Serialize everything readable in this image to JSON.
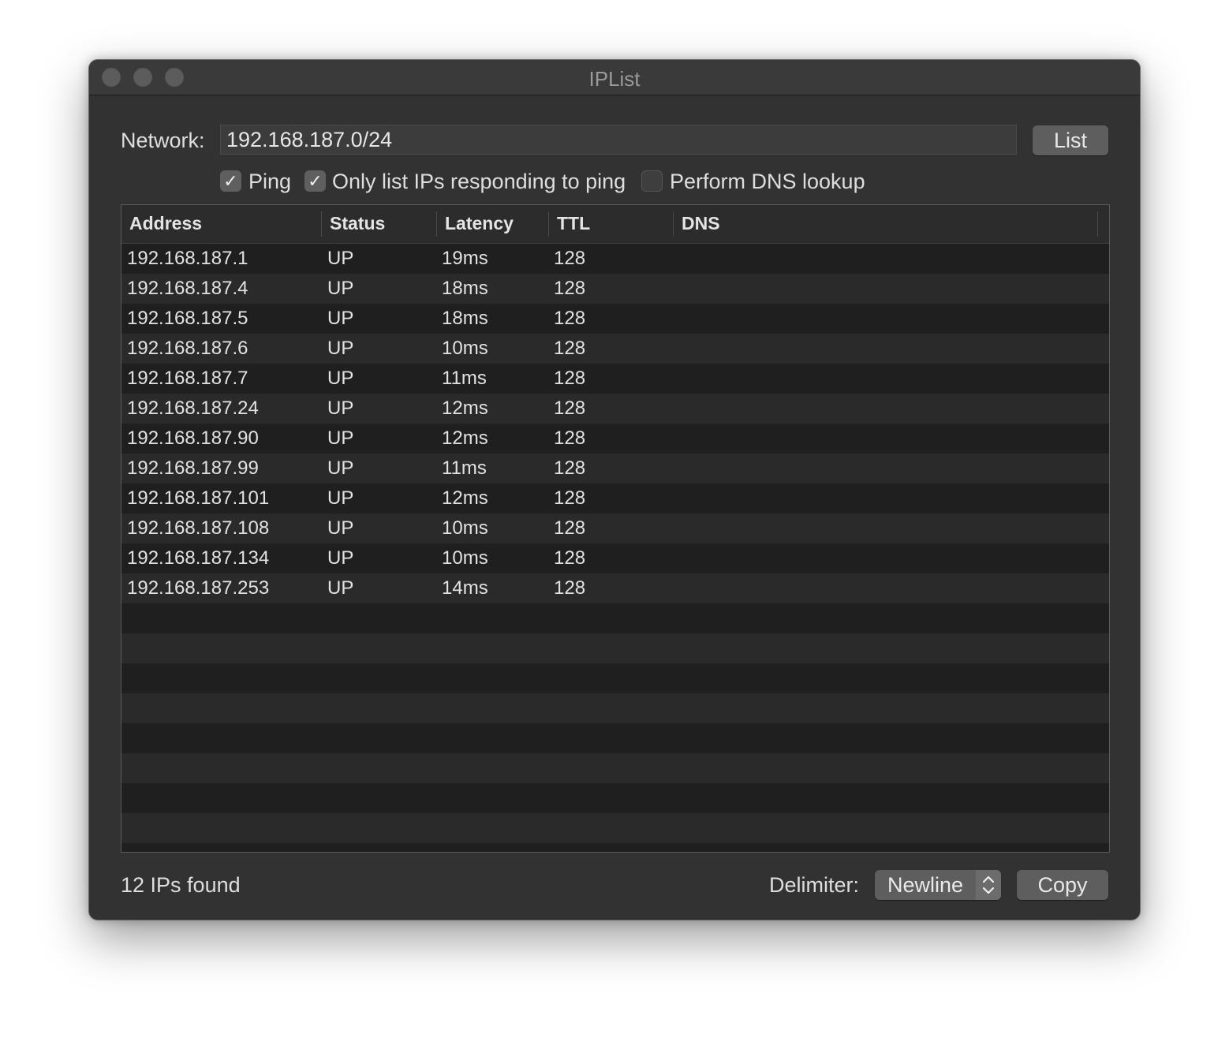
{
  "window": {
    "title": "IPList"
  },
  "form": {
    "network_label": "Network:",
    "network_value": "192.168.187.0/24",
    "list_button": "List",
    "ping_label": "Ping",
    "ping_checked": true,
    "only_responding_label": "Only list IPs responding to ping",
    "only_responding_checked": true,
    "dns_label": "Perform DNS lookup",
    "dns_checked": false
  },
  "table": {
    "columns": [
      "Address",
      "Status",
      "Latency",
      "TTL",
      "DNS"
    ],
    "rows": [
      {
        "address": "192.168.187.1",
        "status": "UP",
        "latency": "19ms",
        "ttl": "128",
        "dns": ""
      },
      {
        "address": "192.168.187.4",
        "status": "UP",
        "latency": "18ms",
        "ttl": "128",
        "dns": ""
      },
      {
        "address": "192.168.187.5",
        "status": "UP",
        "latency": "18ms",
        "ttl": "128",
        "dns": ""
      },
      {
        "address": "192.168.187.6",
        "status": "UP",
        "latency": "10ms",
        "ttl": "128",
        "dns": ""
      },
      {
        "address": "192.168.187.7",
        "status": "UP",
        "latency": "11ms",
        "ttl": "128",
        "dns": ""
      },
      {
        "address": "192.168.187.24",
        "status": "UP",
        "latency": "12ms",
        "ttl": "128",
        "dns": ""
      },
      {
        "address": "192.168.187.90",
        "status": "UP",
        "latency": "12ms",
        "ttl": "128",
        "dns": ""
      },
      {
        "address": "192.168.187.99",
        "status": "UP",
        "latency": "11ms",
        "ttl": "128",
        "dns": ""
      },
      {
        "address": "192.168.187.101",
        "status": "UP",
        "latency": "12ms",
        "ttl": "128",
        "dns": ""
      },
      {
        "address": "192.168.187.108",
        "status": "UP",
        "latency": "10ms",
        "ttl": "128",
        "dns": ""
      },
      {
        "address": "192.168.187.134",
        "status": "UP",
        "latency": "10ms",
        "ttl": "128",
        "dns": ""
      },
      {
        "address": "192.168.187.253",
        "status": "UP",
        "latency": "14ms",
        "ttl": "128",
        "dns": ""
      }
    ]
  },
  "footer": {
    "status_text": "12 IPs found",
    "delimiter_label": "Delimiter:",
    "delimiter_value": "Newline",
    "copy_button": "Copy"
  }
}
